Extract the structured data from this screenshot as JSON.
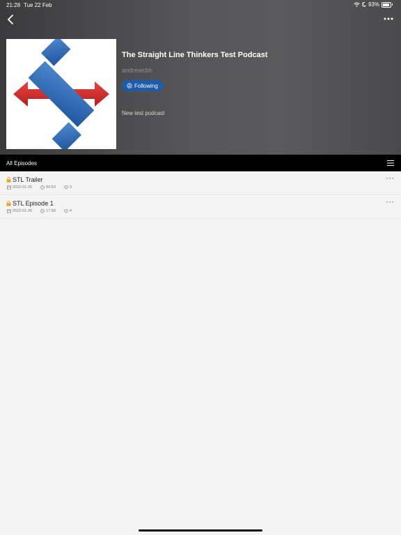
{
  "status_bar": {
    "time": "21:28",
    "date": "Tue 22 Feb",
    "battery": "93%"
  },
  "podcast": {
    "title": "The Straight Line Thinkers Test Podcast",
    "author": "andrewcbh",
    "follow_label": "Following",
    "description": "New test podcast"
  },
  "tabs": {
    "all_episodes": "All Episodes"
  },
  "episodes": [
    {
      "title": "STL Trailer",
      "date": "2022-01-26",
      "duration": "00:53",
      "likes": "3"
    },
    {
      "title": "STL Episode 1",
      "date": "2022-01-26",
      "duration": "17:58",
      "likes": "4"
    }
  ],
  "colors": {
    "follow_button": "#1e5ba8",
    "lock_icon": "#e8a21b",
    "artwork_blue": "#2f6bb5",
    "artwork_red": "#d9302c"
  }
}
